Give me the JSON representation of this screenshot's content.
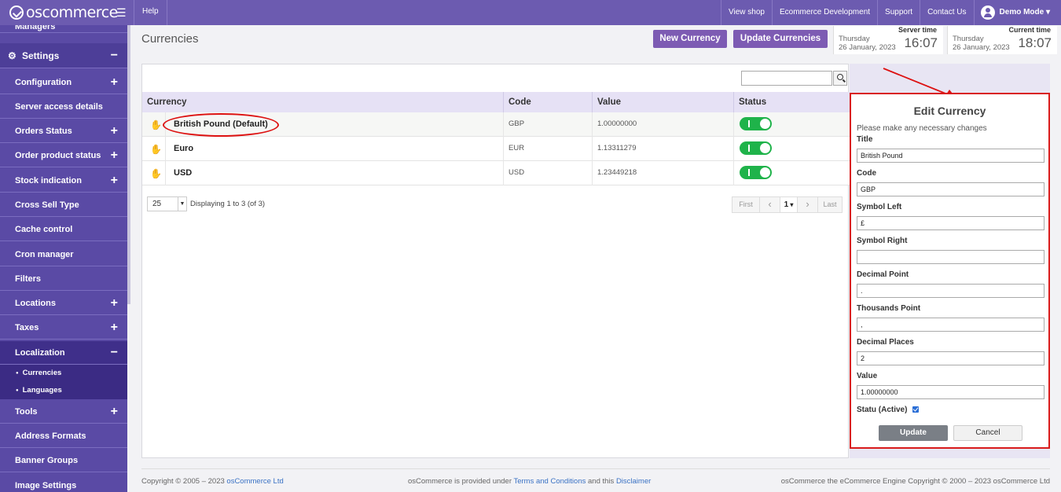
{
  "topbar": {
    "logo_text": "oscommerce",
    "help": "Help",
    "nav": [
      "View shop",
      "Ecommerce Development",
      "Support",
      "Contact Us"
    ],
    "user": "Demo Mode ▾"
  },
  "sidebar": {
    "managers": "Managers",
    "settings": "Settings",
    "items": [
      {
        "label": "Configuration",
        "expand": "+"
      },
      {
        "label": "Server access details",
        "expand": ""
      },
      {
        "label": "Orders Status",
        "expand": "+"
      },
      {
        "label": "Order product status",
        "expand": "+"
      },
      {
        "label": "Stock indication",
        "expand": "+"
      },
      {
        "label": "Cross Sell Type",
        "expand": ""
      },
      {
        "label": "Cache control",
        "expand": ""
      },
      {
        "label": "Cron manager",
        "expand": ""
      },
      {
        "label": "Filters",
        "expand": ""
      },
      {
        "label": "Locations",
        "expand": "+"
      },
      {
        "label": "Taxes",
        "expand": "+"
      },
      {
        "label": "Localization",
        "expand": "−"
      }
    ],
    "sub_items": [
      "Currencies",
      "Languages"
    ],
    "items_after": [
      {
        "label": "Tools",
        "expand": "+"
      },
      {
        "label": "Address Formats",
        "expand": ""
      },
      {
        "label": "Banner Groups",
        "expand": ""
      },
      {
        "label": "Image Settings",
        "expand": ""
      }
    ]
  },
  "header": {
    "title": "Currencies",
    "new_button": "New Currency",
    "update_button": "Update Currencies",
    "server_time": {
      "label": "Server time",
      "day": "Thursday",
      "date": "26 January, 2023",
      "time": "16:07"
    },
    "current_time": {
      "label": "Current time",
      "day": "Thursday",
      "date": "26 January, 2023",
      "time": "18:07"
    }
  },
  "table": {
    "columns": [
      "Currency",
      "Code",
      "Value",
      "Status"
    ],
    "rows": [
      {
        "currency": "British Pound (Default)",
        "code": "GBP",
        "value": "1.00000000",
        "active": true
      },
      {
        "currency": "Euro",
        "code": "EUR",
        "value": "1.13311279",
        "active": true
      },
      {
        "currency": "USD",
        "code": "USD",
        "value": "1.23449218",
        "active": true
      }
    ],
    "per_page": "25",
    "displaying": "Displaying 1 to 3 (of 3)",
    "pager": {
      "first": "First",
      "prev": "‹",
      "page": "1",
      "next": "›",
      "last": "Last"
    }
  },
  "edit_panel": {
    "title": "Edit Currency",
    "subtitle": "Please make any necessary changes",
    "fields": [
      {
        "label": "Title",
        "value": "British Pound"
      },
      {
        "label": "Code",
        "value": "GBP"
      },
      {
        "label": "Symbol Left",
        "value": "£"
      },
      {
        "label": "Symbol Right",
        "value": ""
      },
      {
        "label": "Decimal Point",
        "value": "."
      },
      {
        "label": "Thousands Point",
        "value": ","
      },
      {
        "label": "Decimal Places",
        "value": "2"
      },
      {
        "label": "Value",
        "value": "1.00000000"
      }
    ],
    "status_label": "Statu (Active)",
    "status_checked": true,
    "update_button": "Update",
    "cancel_button": "Cancel"
  },
  "footer": {
    "copyright_left": "Copyright © 2005 – 2023 ",
    "copyright_left_link": "osCommerce Ltd",
    "middle_1": "osCommerce is provided under ",
    "middle_link_1": "Terms and Conditions",
    "middle_2": " and this ",
    "middle_link_2": "Disclaimer",
    "right": "osCommerce the eCommerce Engine Copyright © 2000 – 2023 osCommerce Ltd"
  },
  "colors": {
    "topbar": "#6c5bb0",
    "sidebar": "#5a4aa5",
    "accent_button": "#7d5bb3",
    "toggle_on": "#1fb34a",
    "annotation": "#d11"
  }
}
